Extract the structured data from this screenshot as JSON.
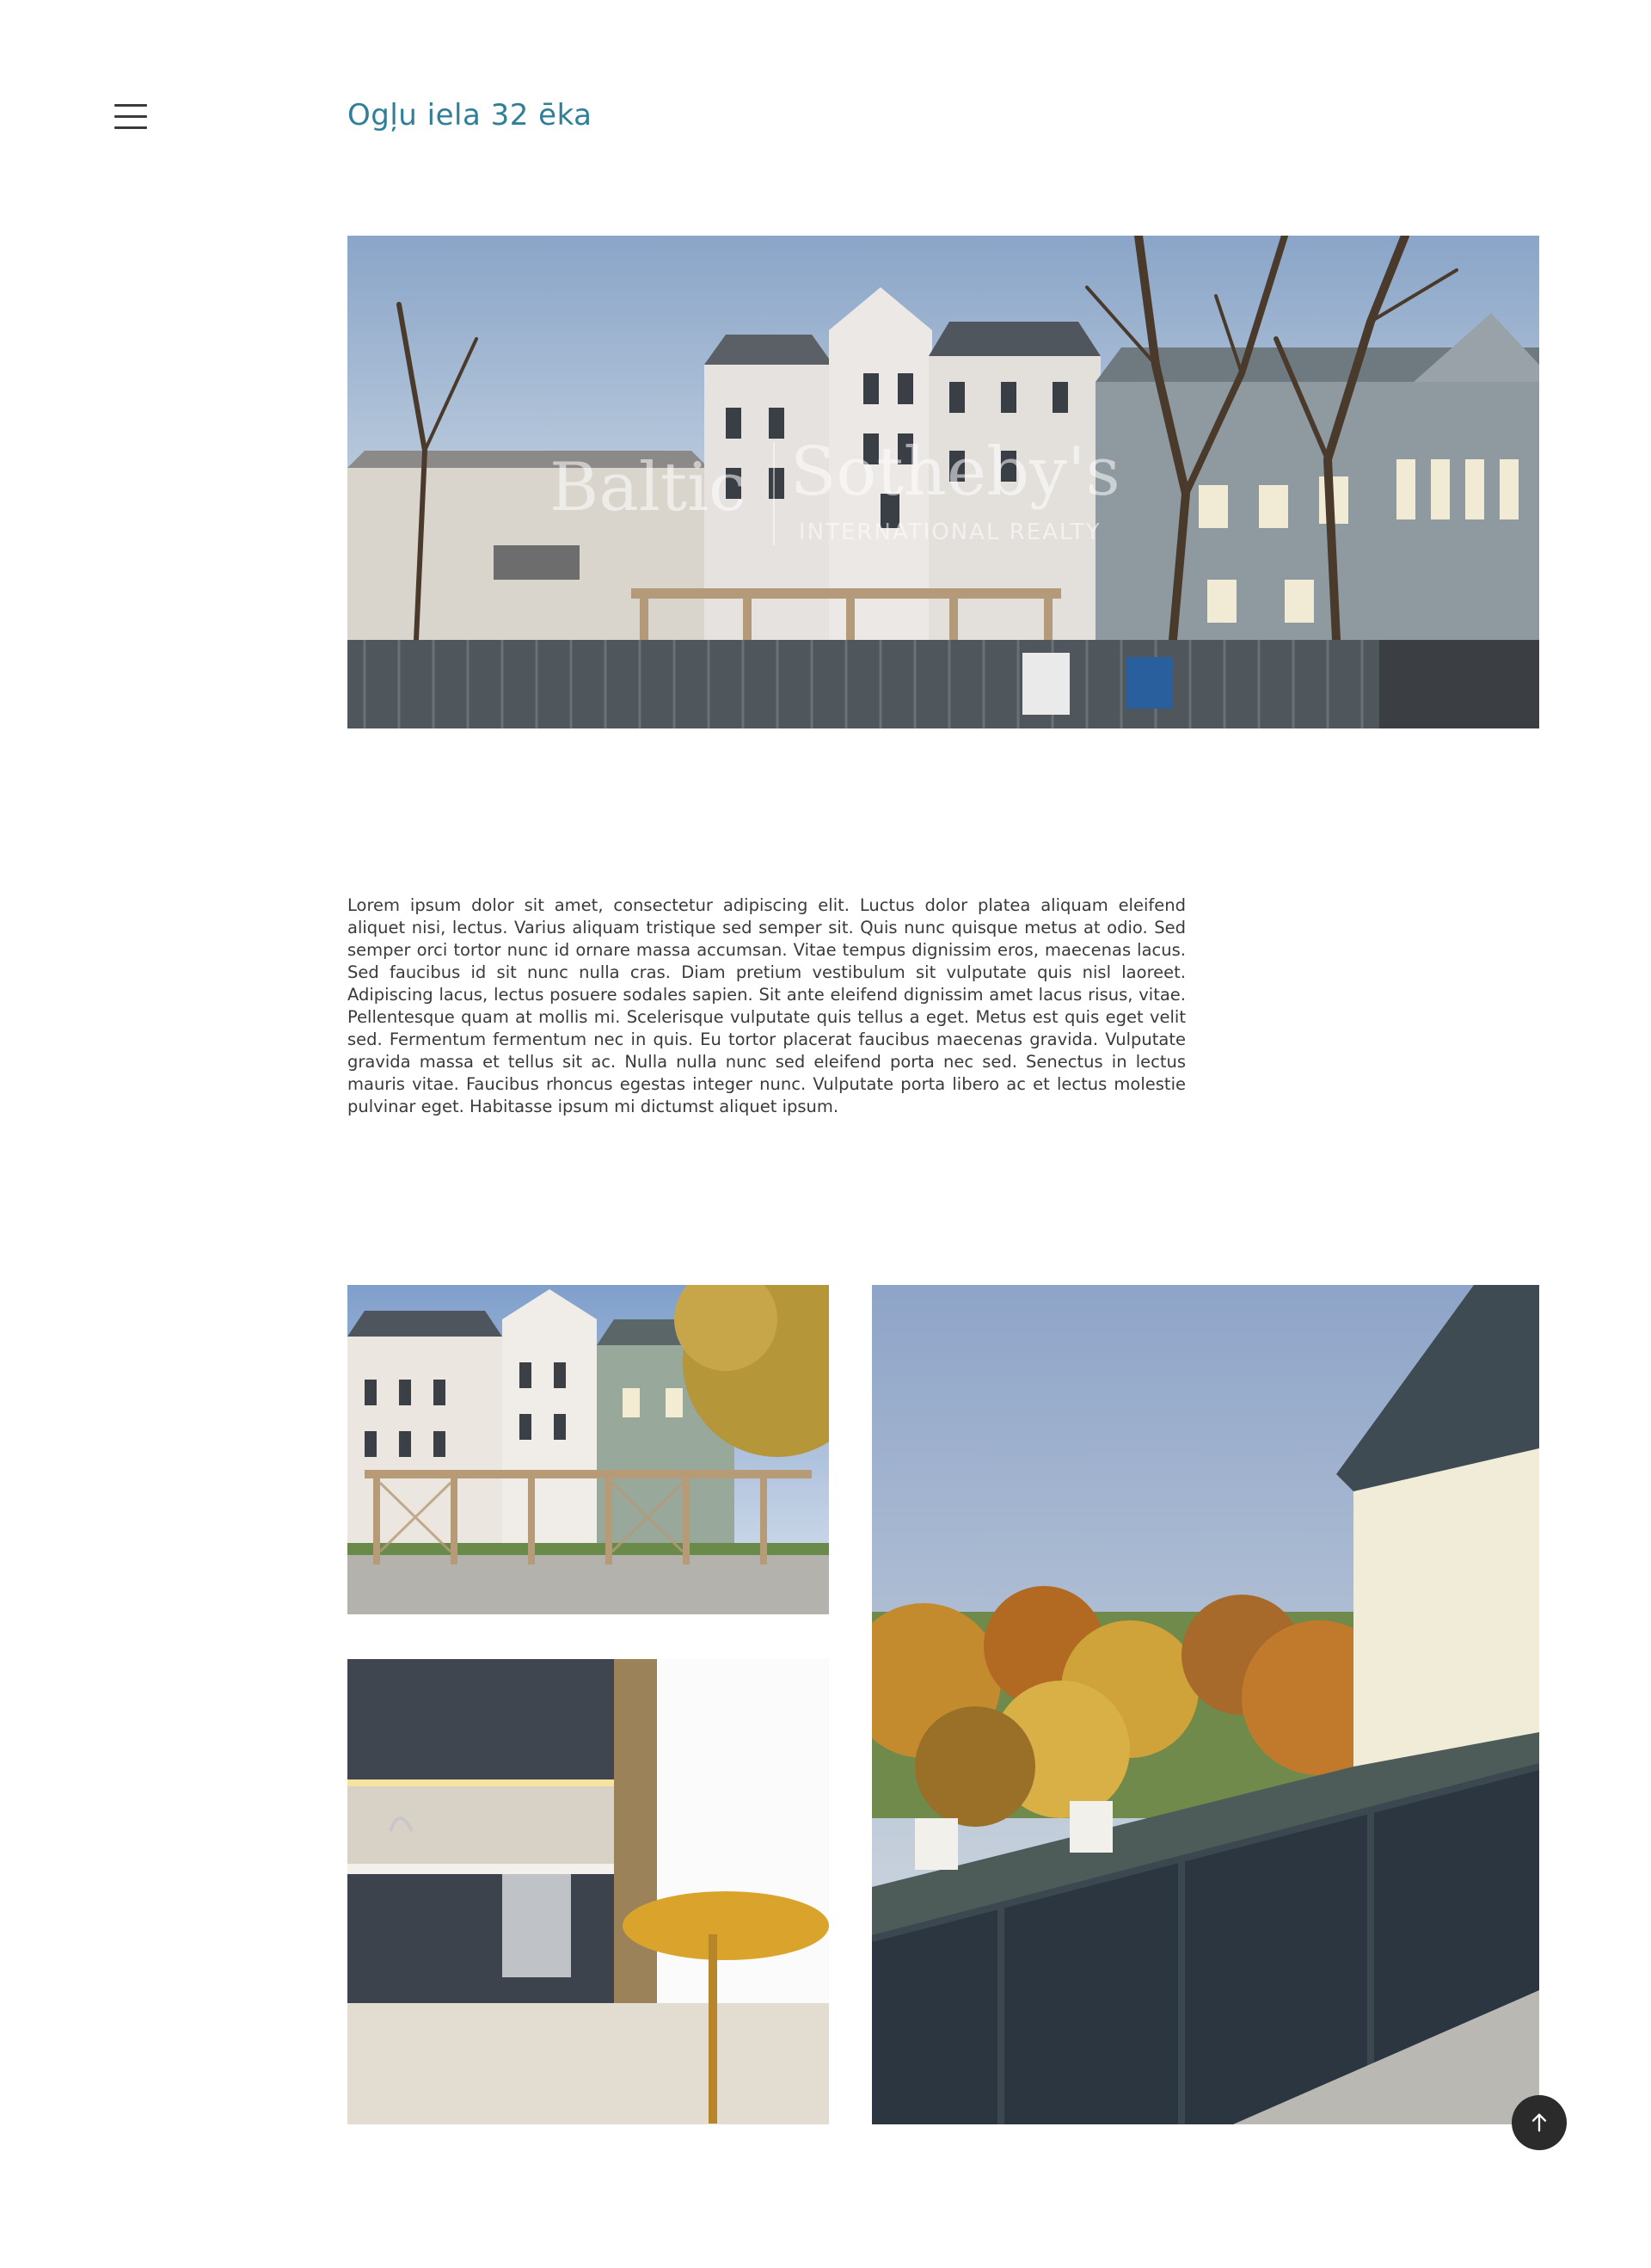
{
  "header": {
    "menu_icon": "hamburger-menu-icon",
    "title": "Ogļu iela 32 ēka"
  },
  "hero": {
    "watermark_left": "Baltic",
    "watermark_right": "Sotheby's",
    "watermark_sub": "INTERNATIONAL REALTY"
  },
  "main": {
    "description": "Lorem ipsum dolor sit amet, consectetur adipiscing elit. Luctus dolor platea aliquam eleifend aliquet nisi, lectus. Varius aliquam tristique sed semper sit. Quis nunc quisque metus at odio. Sed semper orci tortor nunc id ornare massa accumsan. Vitae tempus dignissim eros, maecenas lacus. Sed faucibus id sit nunc nulla cras. Diam pretium vestibulum sit vulputate quis nisl laoreet. Adipiscing lacus, lectus posuere sodales sapien. Sit ante eleifend dignissim amet lacus risus, vitae. Pellentesque quam at mollis mi. Scelerisque vulputate quis tellus a eget. Metus est quis eget velit sed. Fermentum fermentum nec in quis. Eu tortor placerat faucibus maecenas gravida. Vulputate gravida massa et tellus sit ac. Nulla nulla nunc sed eleifend porta nec sed. Senectus in lectus mauris vitae. Faucibus rhoncus egestas integer nunc. Vulputate porta libero ac et lectus molestie pulvinar eget. Habitasse ipsum mi dictumst aliquet ipsum."
  },
  "gallery": {
    "images": [
      "courtyard-photo",
      "kitchen-photo",
      "balcony-view-photo"
    ]
  },
  "controls": {
    "scroll_top_icon": "arrow-up-icon"
  },
  "colors": {
    "title": "#2f7f99",
    "text": "#3a3a3a",
    "button": "#2b2b2b"
  }
}
